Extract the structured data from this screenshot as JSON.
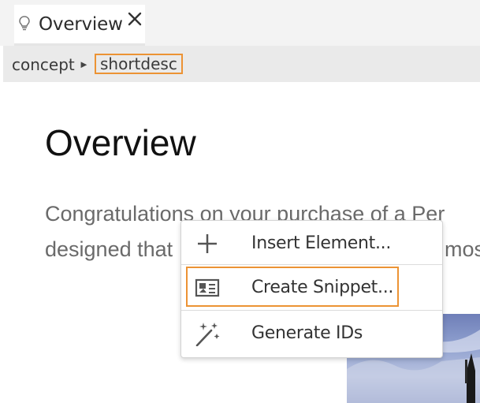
{
  "tab": {
    "title": "Overview",
    "icon": "lightbulb-icon",
    "close_icon": "close-icon"
  },
  "breadcrumb": {
    "items": [
      "concept"
    ],
    "separator": "►",
    "current": "shortdesc"
  },
  "document": {
    "title": "Overview",
    "lines": [
      "Congratulations on your purchase of a Per",
      "designed that",
      "most"
    ]
  },
  "context_menu": {
    "items": [
      {
        "label": "Insert Element...",
        "icon": "plus-icon"
      },
      {
        "label": "Create Snippet...",
        "icon": "snippet-card-icon"
      },
      {
        "label": "Generate IDs",
        "icon": "magic-wand-icon"
      }
    ]
  },
  "colors": {
    "highlight": "#ec9334",
    "background": "#f3f3f3"
  }
}
